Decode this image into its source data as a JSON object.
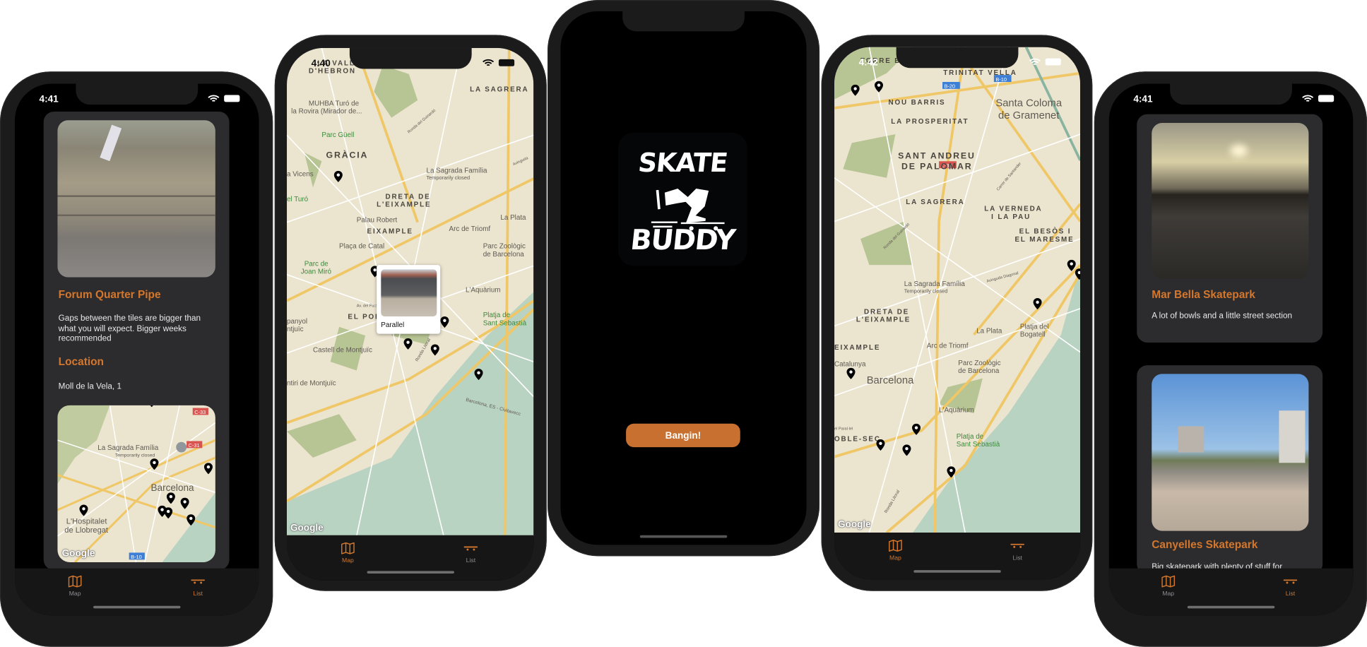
{
  "app_name": "Skate Buddy",
  "colors": {
    "accent": "#d4772c",
    "button": "#c87030",
    "card": "#2c2c2e",
    "map_land": "#ebe4cf",
    "map_water": "#b9d3c2",
    "map_park": "#b7c493"
  },
  "tabs": {
    "map_label": "Map",
    "list_label": "List",
    "map_icon": "map-icon",
    "list_icon": "skateboard-icon"
  },
  "phone_detail": {
    "time": "4:41",
    "spot_title": "Forum Quarter Pipe",
    "spot_description": "Gaps between the tiles are bigger than what you will expect. Bigger weeks recommended",
    "location_heading": "Location",
    "address": "Moll de la Vela, 1",
    "map_labels": {
      "sagrada": "La Sagrada Família",
      "closed": "Temporarily closed",
      "city": "Barcelona",
      "hosp1": "L'Hospitalet",
      "hosp2": "de Llobregat",
      "c33": "C-33",
      "c31": "C-31",
      "b10": "B-10"
    },
    "google": "Google",
    "active_tab": "list"
  },
  "phone_map_a": {
    "time": "4:40",
    "callout_title": "Parallel",
    "map_labels": {
      "vall1": "LA VALL",
      "vall2": "D'HEBRON",
      "sagrera": "LA SAGRERA",
      "muhba1": "MUHBA Turó de",
      "muhba2": "la Rovira (Mirador de...",
      "guell": "Parc Güell",
      "gracia": "GRÀCIA",
      "vicens": "a Vicens",
      "sagrada": "La Sagrada Família",
      "closed": "Temporarily closed",
      "turo": "el Turó",
      "dreta1": "DRETA DE",
      "dreta2": "L'EIXAMPLE",
      "palau": "Palau Robert",
      "plata": "La Plata",
      "eixample": "EIXAMPLE",
      "arc": "Arc de Triomf",
      "catal": "Plaça de Catal",
      "zoo1": "Parc Zoològic",
      "zoo2": "de Barcelona",
      "miro1": "Parc de",
      "miro2": "Joan Miró",
      "aquarium": "L'Aquàrium",
      "paralel": "Av. del Paral·lel",
      "poblesec": "EL POBLE-SEC",
      "platja1": "Platja de",
      "platja2": "Sant Sebastià",
      "panyol": "panyol",
      "ntjuic": "ntjuïc",
      "castell": "Castell de Montjuïc",
      "ronda": "Ronda Litoral",
      "mirador": "ntiri de Montjuïc",
      "guinardo": "Ronda del Guinardó",
      "ferry": "Barcelona, ES - Civitavecc",
      "avinguda": "Avinguda"
    },
    "google": "Google",
    "active_tab": "map"
  },
  "phone_splash": {
    "logo_text_top": "SKATE",
    "logo_text_bottom": "BUDDY",
    "button_label": "Bangin!"
  },
  "phone_map_b": {
    "time": "4:42",
    "map_labels": {
      "torre": "TORRE BA",
      "trinitat": "TRINITAT VELLA",
      "noubarris": "NOU BARRIS",
      "b20": "B-20",
      "b10": "B-10",
      "santa1": "Santa Coloma",
      "santa2": "de Gramenet",
      "prosperitat": "LA PROSPERITAT",
      "andreu1": "SANT ANDREU",
      "andreu2": "DE PALOMAR",
      "c33": "C-33",
      "sagrera": "LA SAGRERA",
      "verneda1": "LA VERNEDA",
      "verneda2": "I LA PAU",
      "besos1": "EL BESÒS I",
      "besos2": "EL MARESME",
      "santander": "Carrer de Santander",
      "guinardo": "Ronda del Guinardó",
      "sagrada": "La Sagrada Família",
      "closed": "Temporarily closed",
      "diagonal": "Avinguda Diagonal",
      "dreta1": "DRETA DE",
      "dreta2": "L'EIXAMPLE",
      "plata": "La Plata",
      "bogatell1": "Platja del",
      "bogatell2": "Bogatell",
      "eixample": "EIXAMPLE",
      "arc": "Arc de Triomf",
      "catalunya": "Catalunya",
      "zoo1": "Parc Zoològic",
      "zoo2": "de Barcelona",
      "city": "Barcelona",
      "aquarium": "L'Aquàrium",
      "paralel": "el Paral·lel",
      "poblesec": "OBLE-SEC",
      "platja1": "Platja de",
      "platja2": "Sant Sebastià",
      "ronda": "Ronda Litoral"
    },
    "google": "Google",
    "active_tab": "map"
  },
  "phone_list": {
    "time": "4:41",
    "spots": [
      {
        "title": "Mar Bella Skatepark",
        "description": "A lot of bowls and a little street section"
      },
      {
        "title": "Canyelles Skatepark",
        "description": "Big skatepark with plenty of stuff for"
      }
    ],
    "active_tab": "list"
  }
}
